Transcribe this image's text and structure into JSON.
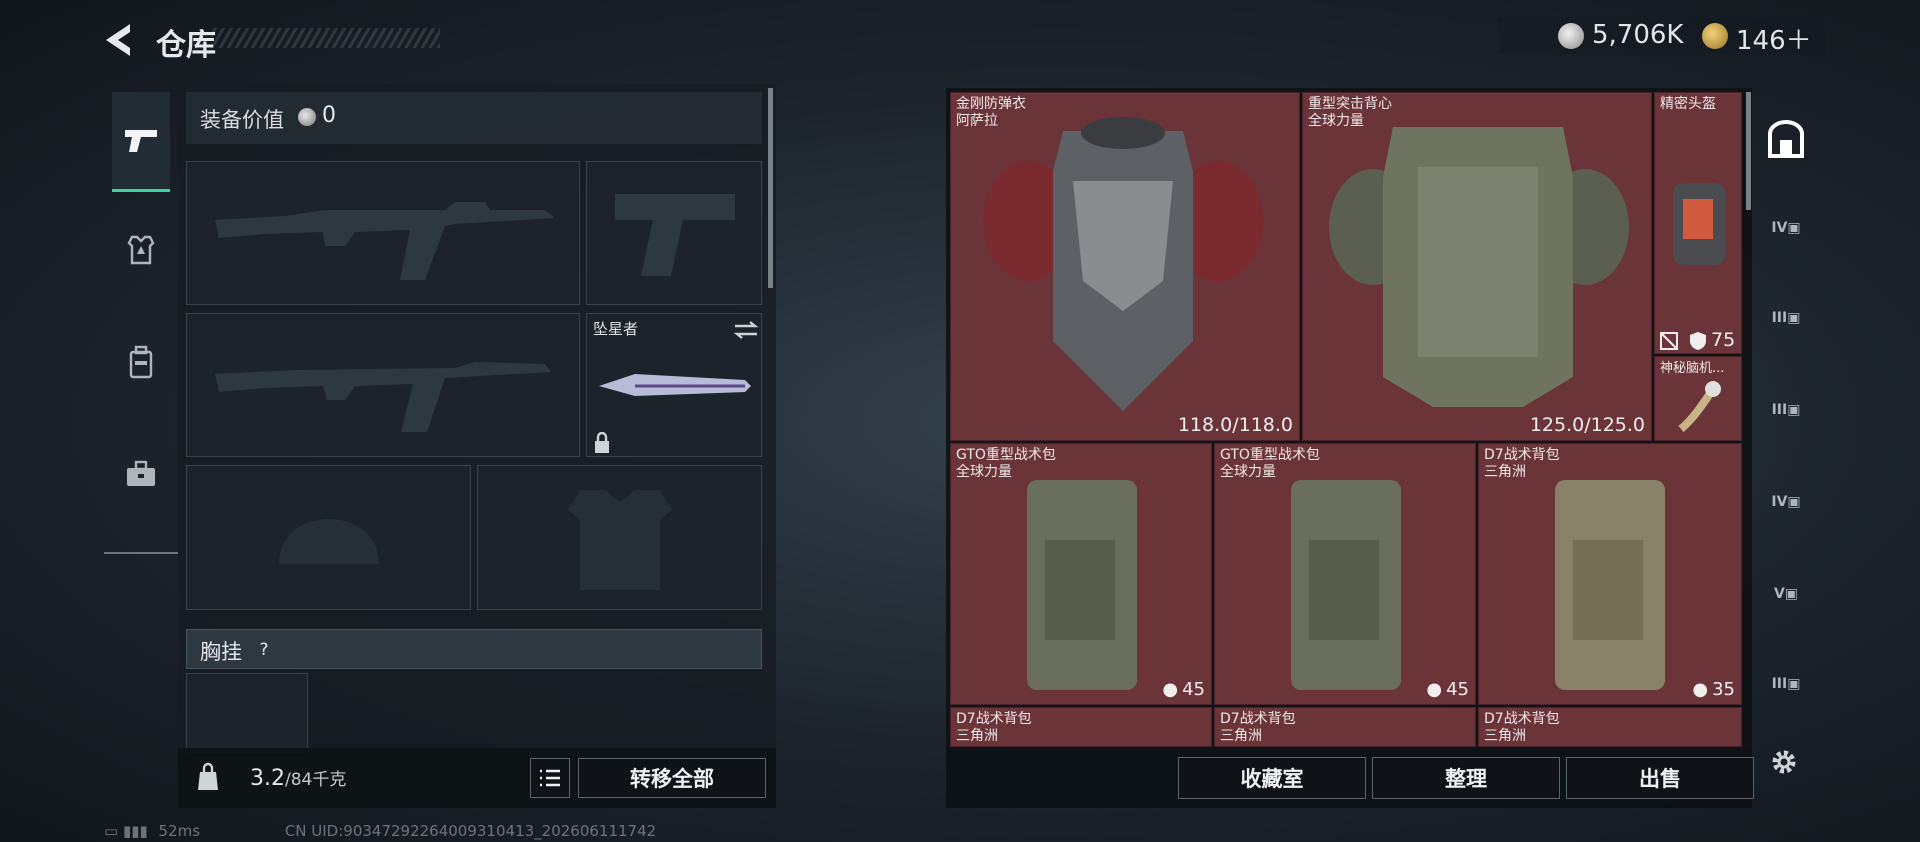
{
  "header": {
    "title": "仓库",
    "currencies": [
      {
        "icon": "silver-coin-icon",
        "value": "5,706K"
      },
      {
        "icon": "gold-triangle-coin-icon",
        "value": "146＋"
      }
    ]
  },
  "left": {
    "tabs": [
      {
        "icon": "pistol-icon",
        "active": true
      },
      {
        "icon": "armor-vest-icon",
        "active": false
      },
      {
        "icon": "backpack-icon",
        "active": false
      },
      {
        "icon": "toolbox-icon",
        "active": false
      }
    ],
    "equip_value_label": "装备价值",
    "equip_value": "0",
    "melee_name": "坠星者",
    "chest_rig_label": "胸挂",
    "help_label": "?",
    "weight": "3.2",
    "weight_max": "/84千克",
    "transfer_all": "转移全部"
  },
  "grid": {
    "items": [
      {
        "name": "金刚防弹衣\n阿萨拉",
        "durability": "118.0/118.0"
      },
      {
        "name": "重型突击背心\n全球力量",
        "durability": "125.0/125.0"
      },
      {
        "name": "精密头盔",
        "armor": "75"
      },
      {
        "name": "神秘脑机..."
      },
      {
        "name": "GTO重型战术包\n全球力量",
        "capacity": "45"
      },
      {
        "name": "GTO重型战术包\n全球力量",
        "capacity": "45"
      },
      {
        "name": "D7战术背包\n三角洲",
        "capacity": "35"
      },
      {
        "name": "D7战术背包\n三角洲"
      },
      {
        "name": "D7战术背包\n三角洲"
      },
      {
        "name": "D7战术背包\n三角洲"
      }
    ],
    "buttons": {
      "collection": "收藏室",
      "sort": "整理",
      "sell": "出售"
    }
  },
  "side_icons": [
    "storage-house-icon",
    "tier-iv-case-icon",
    "tier-iii-case-icon",
    "tier-iii-armor-case-icon",
    "tier-iv-folder-icon",
    "tier-v-case-icon",
    "tier-iii-case-icon-2"
  ],
  "status": {
    "ping": "52ms",
    "uid": "CN UID:9034729226400931041​3_202606111742"
  },
  "colors": {
    "accent": "#3ad6a0",
    "cell_red": "#6a3438"
  }
}
